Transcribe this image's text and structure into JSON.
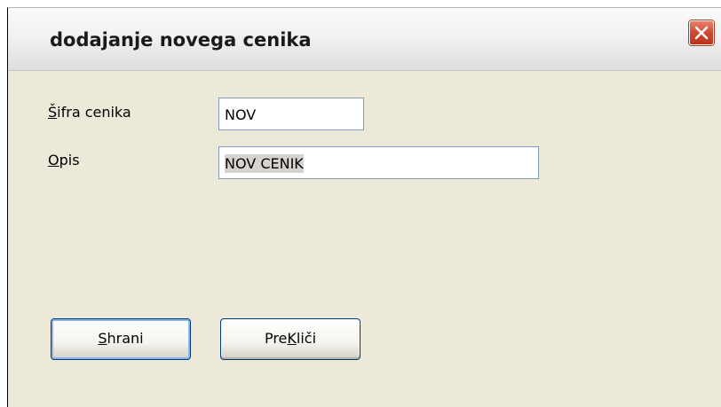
{
  "dialog": {
    "title": "dodajanje novega cenika",
    "close_icon": "close-x-icon"
  },
  "fields": {
    "code": {
      "label_accel": "Š",
      "label_rest": "ifra cenika",
      "value": "NOV"
    },
    "description": {
      "label_accel": "O",
      "label_rest": "pis",
      "value": "NOV CENIK"
    }
  },
  "buttons": {
    "save": {
      "accel": "S",
      "rest": "hrani"
    },
    "cancel": {
      "pre": "Pre",
      "accel": "K",
      "rest": "liči"
    }
  },
  "colors": {
    "window_bg": "#ece9d8",
    "close_red": "#cf4a33",
    "field_border": "#7f9db9",
    "selection_bg": "#d6d3ce",
    "button_border": "#003c74"
  }
}
